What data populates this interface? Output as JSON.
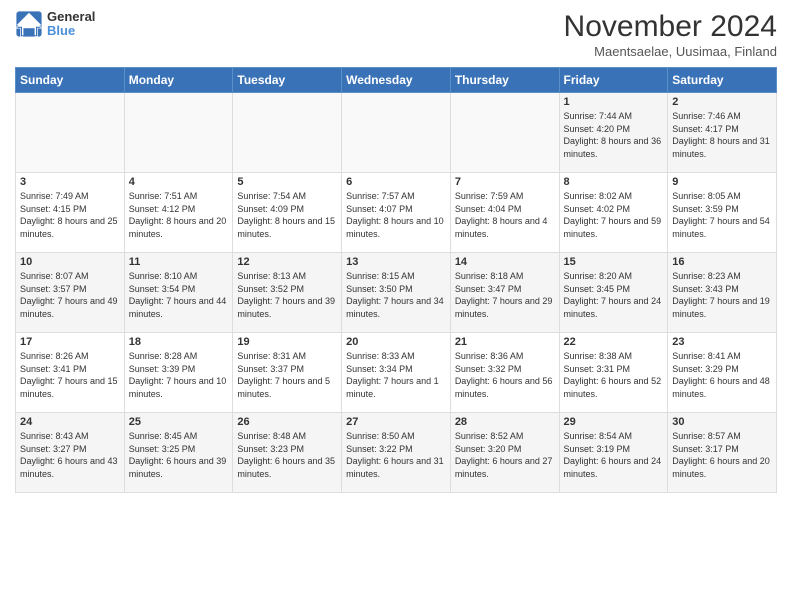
{
  "logo": {
    "line1": "General",
    "line2": "Blue"
  },
  "title": "November 2024",
  "subtitle": "Maentsaelae, Uusimaa, Finland",
  "headers": [
    "Sunday",
    "Monday",
    "Tuesday",
    "Wednesday",
    "Thursday",
    "Friday",
    "Saturday"
  ],
  "weeks": [
    [
      {
        "day": "",
        "sunrise": "",
        "sunset": "",
        "daylight": ""
      },
      {
        "day": "",
        "sunrise": "",
        "sunset": "",
        "daylight": ""
      },
      {
        "day": "",
        "sunrise": "",
        "sunset": "",
        "daylight": ""
      },
      {
        "day": "",
        "sunrise": "",
        "sunset": "",
        "daylight": ""
      },
      {
        "day": "",
        "sunrise": "",
        "sunset": "",
        "daylight": ""
      },
      {
        "day": "1",
        "sunrise": "Sunrise: 7:44 AM",
        "sunset": "Sunset: 4:20 PM",
        "daylight": "Daylight: 8 hours and 36 minutes."
      },
      {
        "day": "2",
        "sunrise": "Sunrise: 7:46 AM",
        "sunset": "Sunset: 4:17 PM",
        "daylight": "Daylight: 8 hours and 31 minutes."
      }
    ],
    [
      {
        "day": "3",
        "sunrise": "Sunrise: 7:49 AM",
        "sunset": "Sunset: 4:15 PM",
        "daylight": "Daylight: 8 hours and 25 minutes."
      },
      {
        "day": "4",
        "sunrise": "Sunrise: 7:51 AM",
        "sunset": "Sunset: 4:12 PM",
        "daylight": "Daylight: 8 hours and 20 minutes."
      },
      {
        "day": "5",
        "sunrise": "Sunrise: 7:54 AM",
        "sunset": "Sunset: 4:09 PM",
        "daylight": "Daylight: 8 hours and 15 minutes."
      },
      {
        "day": "6",
        "sunrise": "Sunrise: 7:57 AM",
        "sunset": "Sunset: 4:07 PM",
        "daylight": "Daylight: 8 hours and 10 minutes."
      },
      {
        "day": "7",
        "sunrise": "Sunrise: 7:59 AM",
        "sunset": "Sunset: 4:04 PM",
        "daylight": "Daylight: 8 hours and 4 minutes."
      },
      {
        "day": "8",
        "sunrise": "Sunrise: 8:02 AM",
        "sunset": "Sunset: 4:02 PM",
        "daylight": "Daylight: 7 hours and 59 minutes."
      },
      {
        "day": "9",
        "sunrise": "Sunrise: 8:05 AM",
        "sunset": "Sunset: 3:59 PM",
        "daylight": "Daylight: 7 hours and 54 minutes."
      }
    ],
    [
      {
        "day": "10",
        "sunrise": "Sunrise: 8:07 AM",
        "sunset": "Sunset: 3:57 PM",
        "daylight": "Daylight: 7 hours and 49 minutes."
      },
      {
        "day": "11",
        "sunrise": "Sunrise: 8:10 AM",
        "sunset": "Sunset: 3:54 PM",
        "daylight": "Daylight: 7 hours and 44 minutes."
      },
      {
        "day": "12",
        "sunrise": "Sunrise: 8:13 AM",
        "sunset": "Sunset: 3:52 PM",
        "daylight": "Daylight: 7 hours and 39 minutes."
      },
      {
        "day": "13",
        "sunrise": "Sunrise: 8:15 AM",
        "sunset": "Sunset: 3:50 PM",
        "daylight": "Daylight: 7 hours and 34 minutes."
      },
      {
        "day": "14",
        "sunrise": "Sunrise: 8:18 AM",
        "sunset": "Sunset: 3:47 PM",
        "daylight": "Daylight: 7 hours and 29 minutes."
      },
      {
        "day": "15",
        "sunrise": "Sunrise: 8:20 AM",
        "sunset": "Sunset: 3:45 PM",
        "daylight": "Daylight: 7 hours and 24 minutes."
      },
      {
        "day": "16",
        "sunrise": "Sunrise: 8:23 AM",
        "sunset": "Sunset: 3:43 PM",
        "daylight": "Daylight: 7 hours and 19 minutes."
      }
    ],
    [
      {
        "day": "17",
        "sunrise": "Sunrise: 8:26 AM",
        "sunset": "Sunset: 3:41 PM",
        "daylight": "Daylight: 7 hours and 15 minutes."
      },
      {
        "day": "18",
        "sunrise": "Sunrise: 8:28 AM",
        "sunset": "Sunset: 3:39 PM",
        "daylight": "Daylight: 7 hours and 10 minutes."
      },
      {
        "day": "19",
        "sunrise": "Sunrise: 8:31 AM",
        "sunset": "Sunset: 3:37 PM",
        "daylight": "Daylight: 7 hours and 5 minutes."
      },
      {
        "day": "20",
        "sunrise": "Sunrise: 8:33 AM",
        "sunset": "Sunset: 3:34 PM",
        "daylight": "Daylight: 7 hours and 1 minute."
      },
      {
        "day": "21",
        "sunrise": "Sunrise: 8:36 AM",
        "sunset": "Sunset: 3:32 PM",
        "daylight": "Daylight: 6 hours and 56 minutes."
      },
      {
        "day": "22",
        "sunrise": "Sunrise: 8:38 AM",
        "sunset": "Sunset: 3:31 PM",
        "daylight": "Daylight: 6 hours and 52 minutes."
      },
      {
        "day": "23",
        "sunrise": "Sunrise: 8:41 AM",
        "sunset": "Sunset: 3:29 PM",
        "daylight": "Daylight: 6 hours and 48 minutes."
      }
    ],
    [
      {
        "day": "24",
        "sunrise": "Sunrise: 8:43 AM",
        "sunset": "Sunset: 3:27 PM",
        "daylight": "Daylight: 6 hours and 43 minutes."
      },
      {
        "day": "25",
        "sunrise": "Sunrise: 8:45 AM",
        "sunset": "Sunset: 3:25 PM",
        "daylight": "Daylight: 6 hours and 39 minutes."
      },
      {
        "day": "26",
        "sunrise": "Sunrise: 8:48 AM",
        "sunset": "Sunset: 3:23 PM",
        "daylight": "Daylight: 6 hours and 35 minutes."
      },
      {
        "day": "27",
        "sunrise": "Sunrise: 8:50 AM",
        "sunset": "Sunset: 3:22 PM",
        "daylight": "Daylight: 6 hours and 31 minutes."
      },
      {
        "day": "28",
        "sunrise": "Sunrise: 8:52 AM",
        "sunset": "Sunset: 3:20 PM",
        "daylight": "Daylight: 6 hours and 27 minutes."
      },
      {
        "day": "29",
        "sunrise": "Sunrise: 8:54 AM",
        "sunset": "Sunset: 3:19 PM",
        "daylight": "Daylight: 6 hours and 24 minutes."
      },
      {
        "day": "30",
        "sunrise": "Sunrise: 8:57 AM",
        "sunset": "Sunset: 3:17 PM",
        "daylight": "Daylight: 6 hours and 20 minutes."
      }
    ]
  ]
}
